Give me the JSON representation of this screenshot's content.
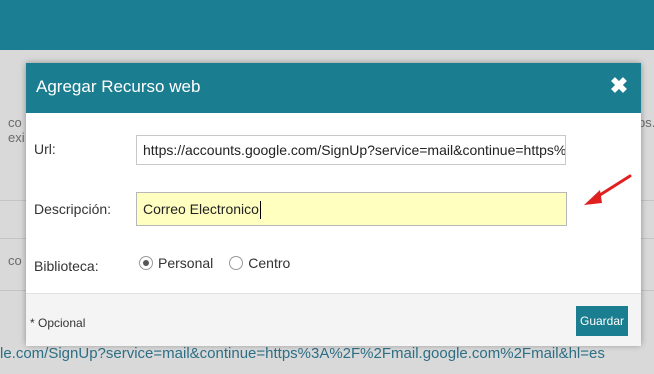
{
  "background": {
    "fragments": [
      "co",
      "exi",
      "co",
      "ps."
    ],
    "url_text": "le.com/SignUp?service=mail&continue=https%3A%2F%2Fmail.google.com%2Fmail&hl=es"
  },
  "modal": {
    "title": "Agregar Recurso web",
    "close_icon": "close-icon",
    "url": {
      "label": "Url:",
      "value": "https://accounts.google.com/SignUp?service=mail&continue=https%3"
    },
    "description": {
      "label": "Descripción:",
      "value": "Correo Electronico"
    },
    "library": {
      "label": "Biblioteca:",
      "options": [
        "Personal",
        "Centro"
      ],
      "selected": "Personal"
    },
    "footer": {
      "note": "* Opcional",
      "save_label": "Guardar"
    }
  },
  "colors": {
    "accent": "#1b7d90",
    "highlight": "#ffffc0",
    "annotation": "#e02020"
  }
}
